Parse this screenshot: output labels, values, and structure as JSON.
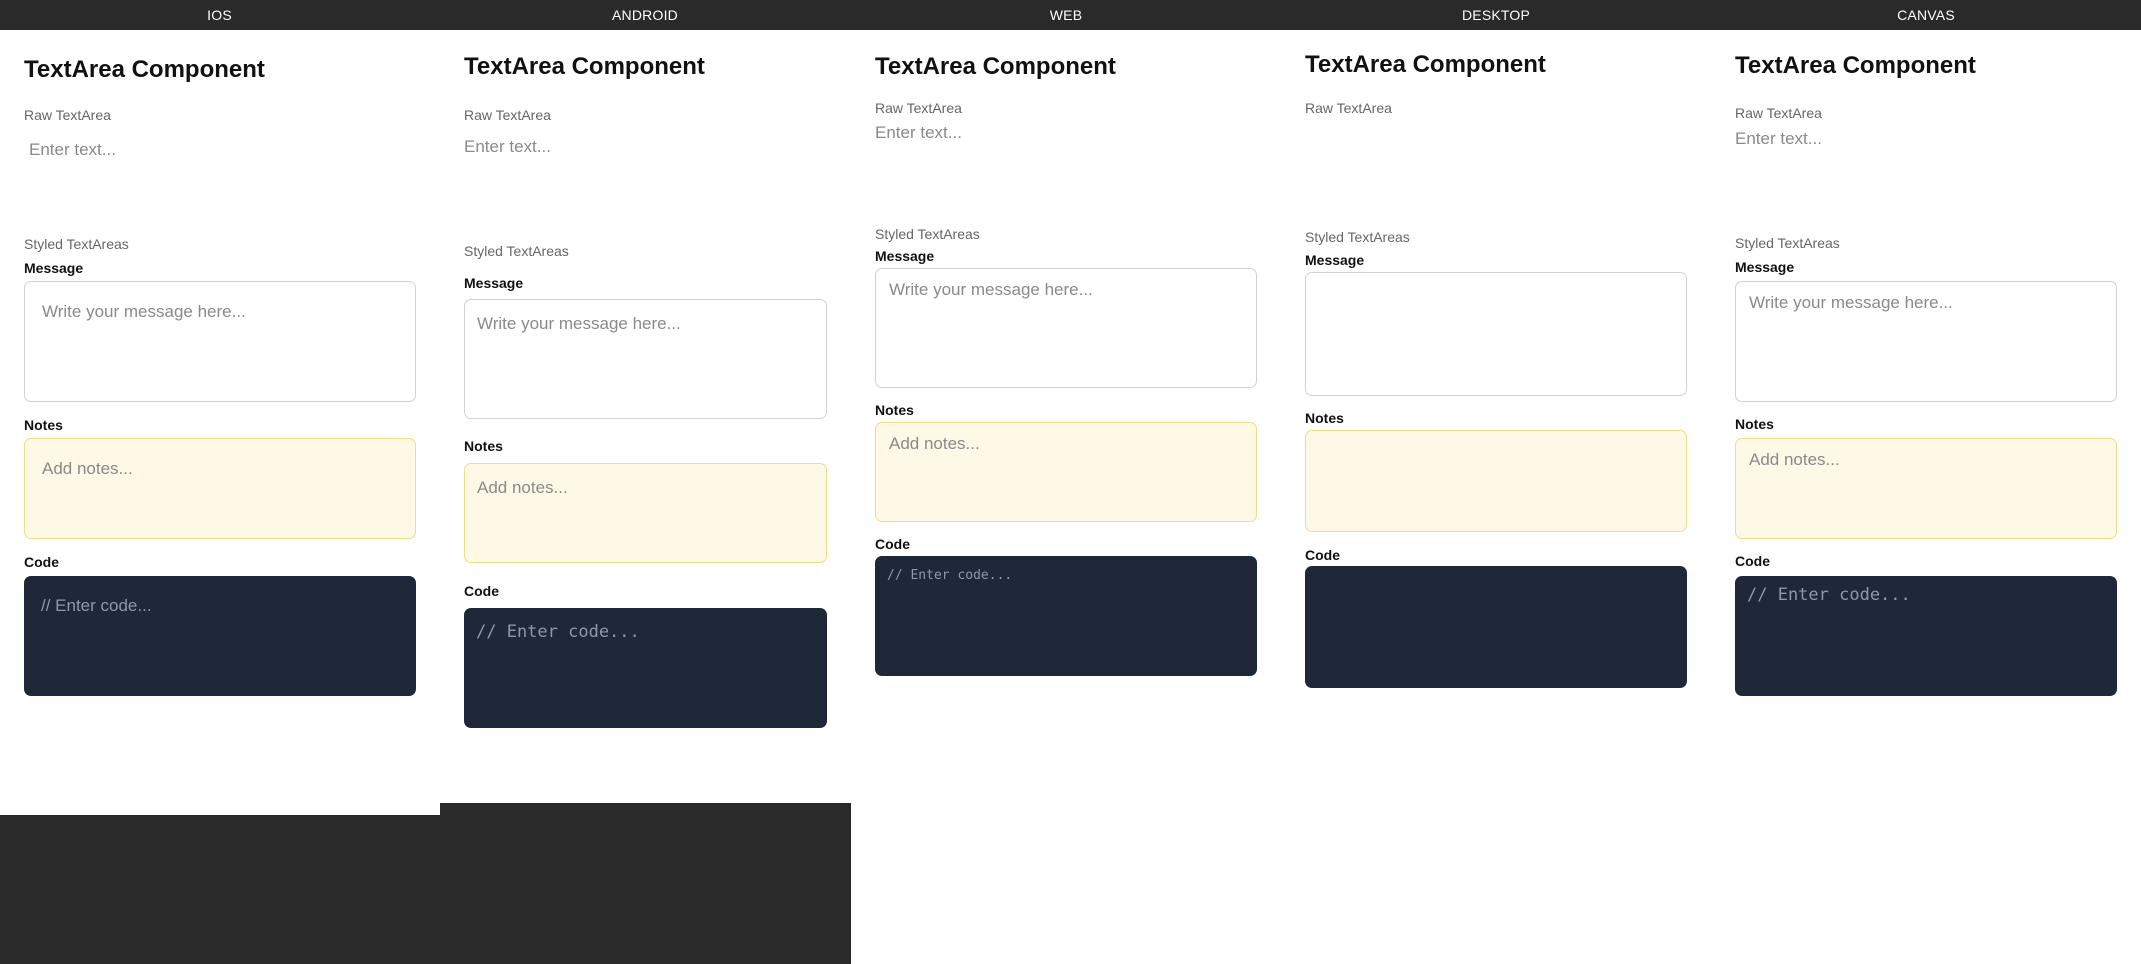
{
  "tabs": [
    {
      "label": "IOS"
    },
    {
      "label": "ANDROID"
    },
    {
      "label": "WEB"
    },
    {
      "label": "DESKTOP"
    },
    {
      "label": "CANVAS"
    }
  ],
  "panels": {
    "ios": {
      "title": "TextArea Component",
      "raw_label": "Raw TextArea",
      "raw_placeholder": "Enter text...",
      "styled_label": "Styled TextAreas",
      "message_label": "Message",
      "message_placeholder": "Write your message here...",
      "notes_label": "Notes",
      "notes_placeholder": "Add notes...",
      "code_label": "Code",
      "code_placeholder": "// Enter code..."
    },
    "android": {
      "title": "TextArea Component",
      "raw_label": "Raw TextArea",
      "raw_placeholder": "Enter text...",
      "styled_label": "Styled TextAreas",
      "message_label": "Message",
      "message_placeholder": "Write your message here...",
      "notes_label": "Notes",
      "notes_placeholder": "Add notes...",
      "code_label": "Code",
      "code_placeholder": "// Enter code..."
    },
    "web": {
      "title": "TextArea Component",
      "raw_label": "Raw TextArea",
      "raw_placeholder": "Enter text...",
      "styled_label": "Styled TextAreas",
      "message_label": "Message",
      "message_placeholder": "Write your message here...",
      "notes_label": "Notes",
      "notes_placeholder": "Add notes...",
      "code_label": "Code",
      "code_placeholder": "// Enter code..."
    },
    "desktop": {
      "title": "TextArea Component",
      "raw_label": "Raw TextArea",
      "styled_label": "Styled TextAreas",
      "message_label": "Message",
      "notes_label": "Notes",
      "code_label": "Code"
    },
    "canvas": {
      "title": "TextArea Component",
      "raw_label": "Raw TextArea",
      "raw_placeholder": "Enter text...",
      "styled_label": "Styled TextAreas",
      "message_label": "Message",
      "message_placeholder": "Write your message here...",
      "notes_label": "Notes",
      "notes_placeholder": "Add notes...",
      "code_label": "Code",
      "code_placeholder": "// Enter code..."
    }
  },
  "colors": {
    "topbar": "#2a2a2a",
    "notes_background": "#fdf9e6",
    "notes_border": "#f2dc86",
    "code_background": "#1e2839",
    "message_border": "#cfd2d6"
  }
}
